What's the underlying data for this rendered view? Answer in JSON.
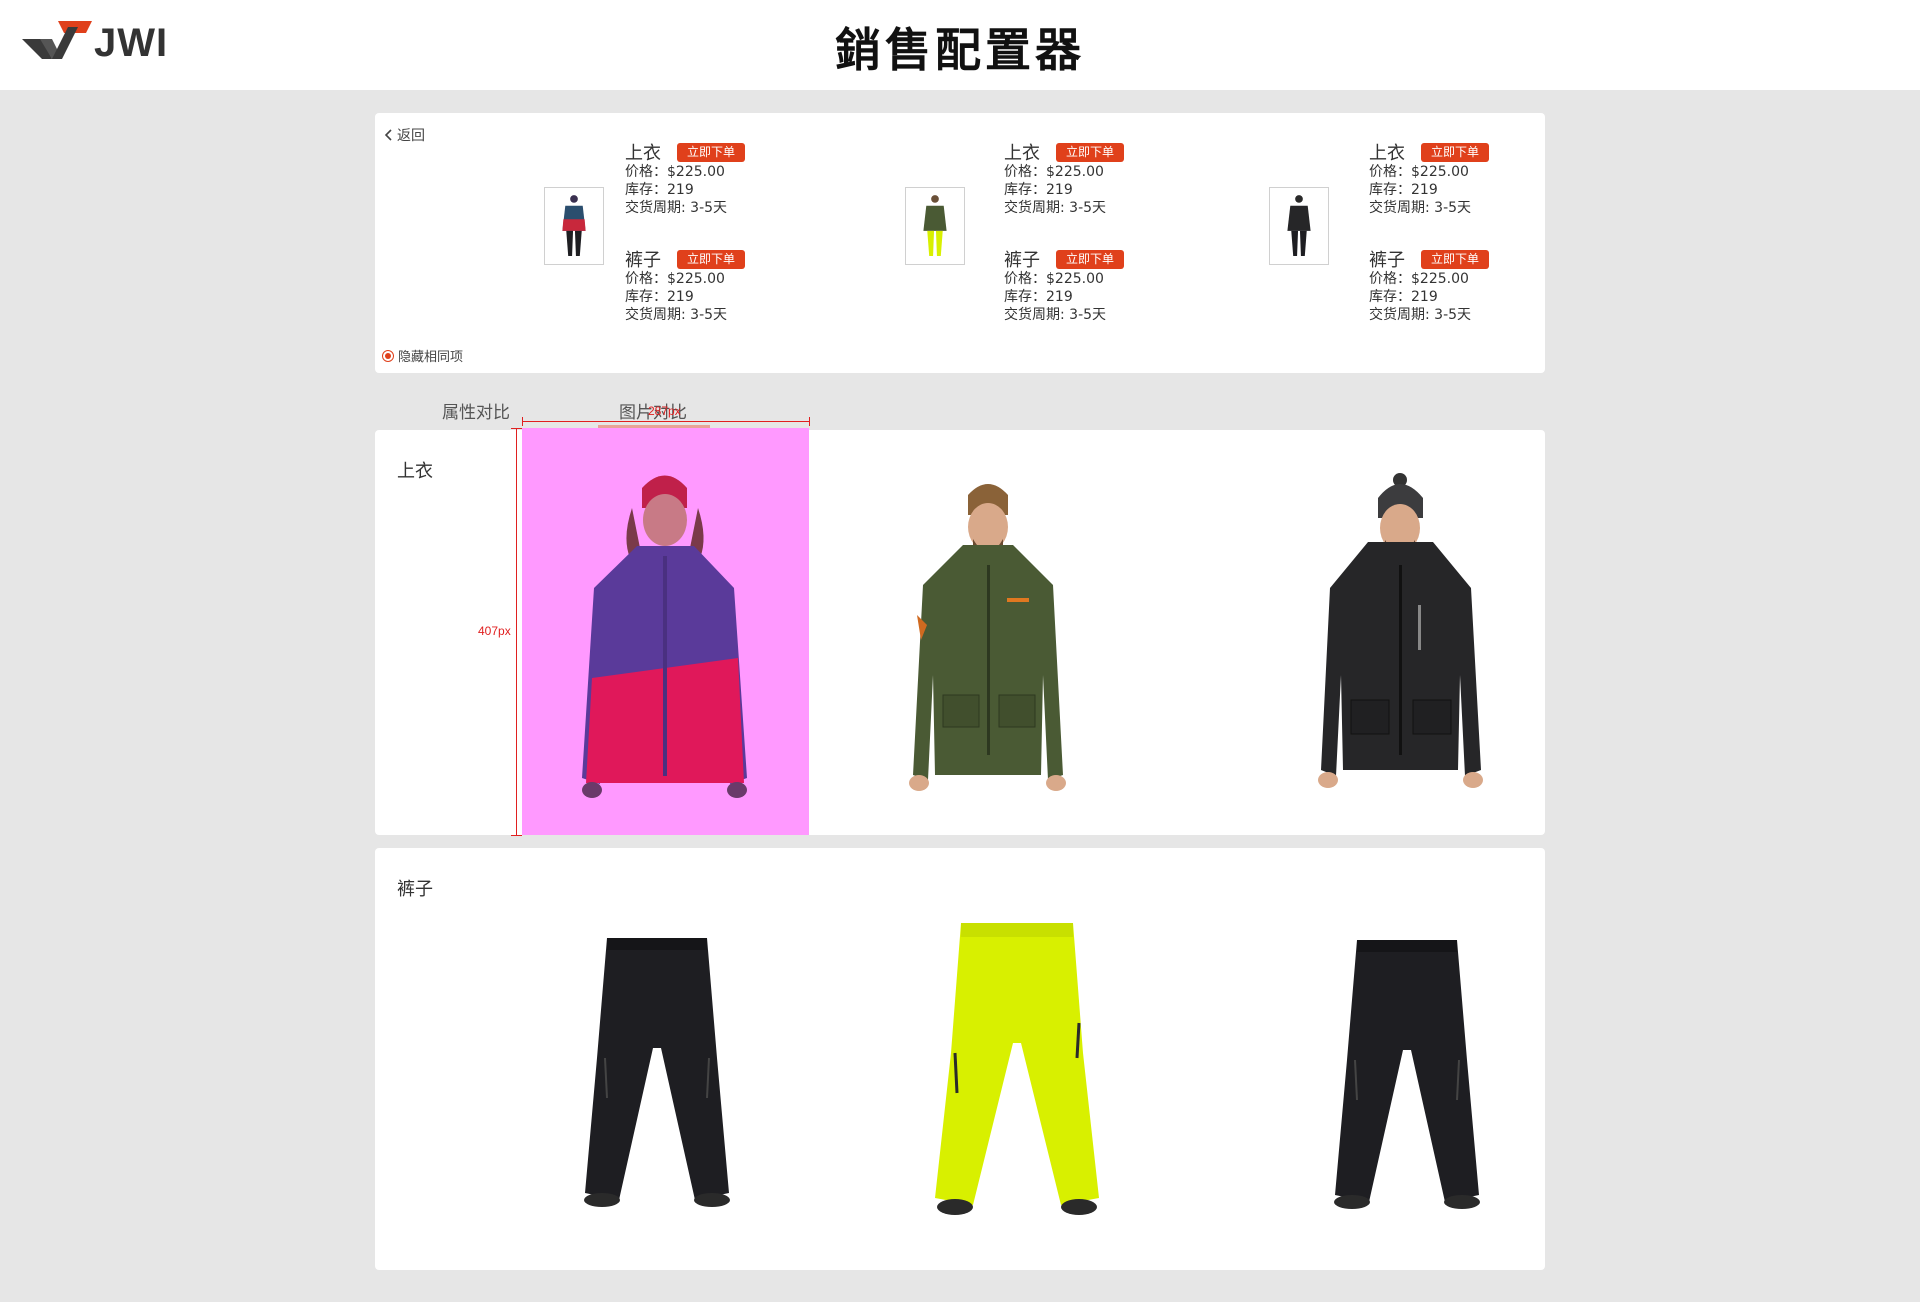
{
  "header": {
    "logo_text": "JWI",
    "title": "銷售配置器"
  },
  "summary": {
    "back_label": "返回",
    "hide_same_label": "隐藏相同项",
    "products": [
      {
        "top": {
          "name": "上衣",
          "button": "立即下单",
          "price": "价格：$225.00",
          "stock": "库存：219",
          "delivery": "交货周期: 3-5天"
        },
        "bottom": {
          "name": "裤子",
          "button": "立即下单",
          "price": "价格：$225.00",
          "stock": "库存：219",
          "delivery": "交货周期: 3-5天"
        }
      },
      {
        "top": {
          "name": "上衣",
          "button": "立即下单",
          "price": "价格：$225.00",
          "stock": "库存：219",
          "delivery": "交货周期: 3-5天"
        },
        "bottom": {
          "name": "裤子",
          "button": "立即下单",
          "price": "价格：$225.00",
          "stock": "库存：219",
          "delivery": "交货周期: 3-5天"
        }
      },
      {
        "top": {
          "name": "上衣",
          "button": "立即下单",
          "price": "价格：$225.00",
          "stock": "库存：219",
          "delivery": "交货周期: 3-5天"
        },
        "bottom": {
          "name": "裤子",
          "button": "立即下单",
          "price": "价格：$225.00",
          "stock": "库存：219",
          "delivery": "交货周期: 3-5天"
        }
      }
    ]
  },
  "tabs": [
    {
      "label": "属性对比"
    },
    {
      "label": "图片对比"
    }
  ],
  "sections": [
    {
      "label": "上衣"
    },
    {
      "label": "裤子"
    }
  ],
  "measure": {
    "width_label": "287px",
    "height_label": "407px"
  },
  "colors": {
    "accent": "#e0401b",
    "highlight": "#ff99ff",
    "jacket_1_top": "#23395c",
    "jacket_1_bottom": "#d8163f",
    "jacket_2": "#4a5a34",
    "jacket_3": "#262628",
    "pants_1": "#1e1e22",
    "pants_2": "#d8f000",
    "pants_3": "#1e1e22"
  }
}
